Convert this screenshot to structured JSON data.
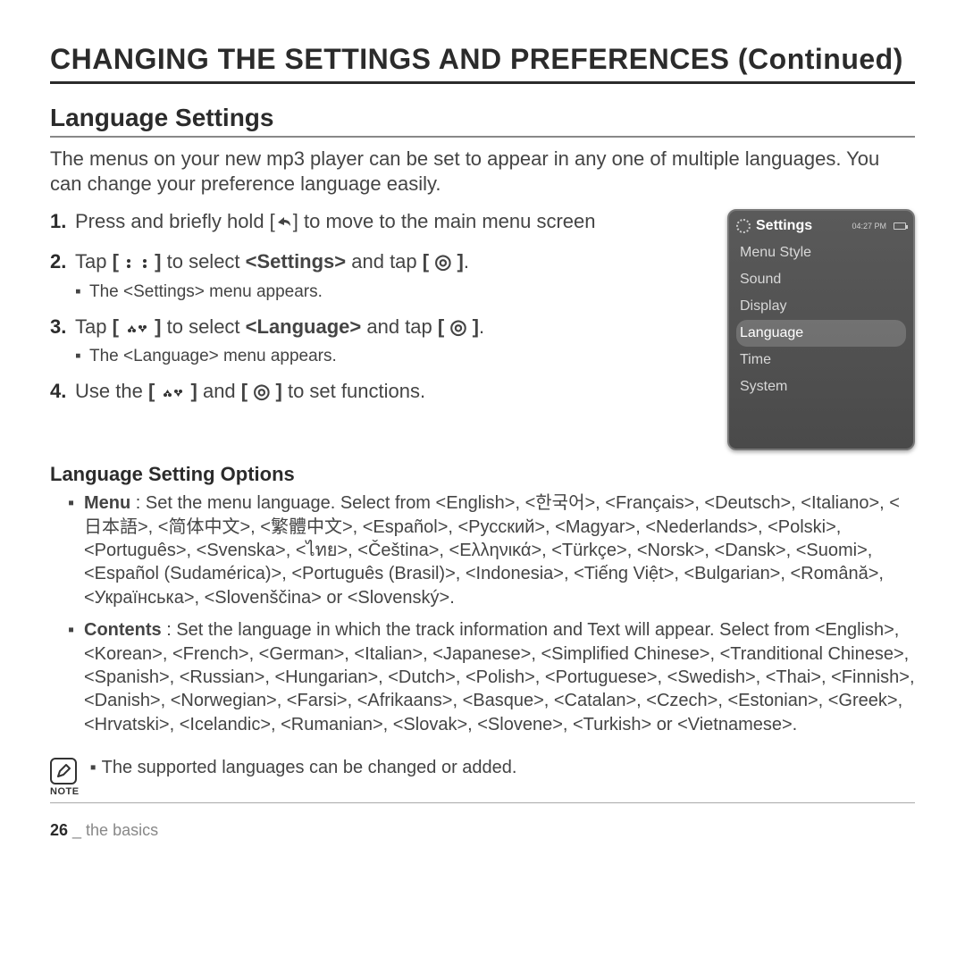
{
  "page_title": "CHANGING THE SETTINGS AND PREFERENCES (Continued)",
  "section_title": "Language Settings",
  "intro": "The menus on your new mp3 player can be set to appear in any one of multiple languages. You can change your preference language easily.",
  "steps": {
    "s1": {
      "num": "1.",
      "body_a": "Press and briefly hold [",
      "body_b": "] to move to the main menu screen"
    },
    "s2": {
      "num": "2.",
      "body_a": "Tap ",
      "bold": "[ ",
      "body_mid": " ]",
      "body_b": " to select ",
      "target": "<Settings>",
      "body_c": " and tap ",
      "btn": "[ ◎ ]",
      "body_d": ".",
      "sub": "The <Settings> menu appears."
    },
    "s3": {
      "num": "3.",
      "body_a": "Tap ",
      "bold": "[ ",
      "body_mid": " ]",
      "body_b": " to select ",
      "target": "<Language>",
      "body_c": " and tap ",
      "btn": "[ ◎ ]",
      "body_d": ".",
      "sub": "The <Language> menu appears."
    },
    "s4": {
      "num": "4.",
      "body_a": "Use the ",
      "bold": "[ ",
      "body_mid": " ]",
      "body_b": " and ",
      "btn": "[ ◎ ]",
      "body_c": " to set functions."
    }
  },
  "device": {
    "title": "Settings",
    "time": "04:27 PM",
    "items": [
      "Menu Style",
      "Sound",
      "Display",
      "Language",
      "Time",
      "System"
    ],
    "selected_index": 3
  },
  "options_title": "Language Setting Options",
  "options": {
    "menu": {
      "lead": "Menu",
      "text": " : Set the menu language. Select from <English>, <한국어>, <Français>, <Deutsch>, <Italiano>, <日本語>, <简体中文>, <繁體中文>, <Español>, <Русский>, <Magyar>, <Nederlands>, <Polski>, <Português>, <Svenska>, <ไทย>, <Čeština>, <Ελληνικά>, <Türkçe>, <Norsk>, <Dansk>, <Suomi>, <Español (Sudamérica)>, <Português (Brasil)>, <Indonesia>, <Tiếng Việt>, <Bulgarian>, <Română>, <Українська>, <Slovenščina> or <Slovenský>."
    },
    "contents": {
      "lead": "Contents",
      "text": " : Set the language in which the track information and Text will appear. Select from <English>, <Korean>, <French>, <German>, <Italian>, <Japanese>, <Simplified Chinese>, <Tranditional Chinese>, <Spanish>, <Russian>, <Hungarian>, <Dutch>, <Polish>, <Portuguese>, <Swedish>, <Thai>, <Finnish>, <Danish>, <Norwegian>, <Farsi>, <Afrikaans>, <Basque>, <Catalan>, <Czech>, <Estonian>, <Greek>, <Hrvatski>, <Icelandic>, <Rumanian>, <Slovak>, <Slovene>, <Turkish> or <Vietnamese>."
    }
  },
  "note_label": "NOTE",
  "note_text": "The supported languages can be changed or added.",
  "footer": {
    "page": "26",
    "sep": " _ ",
    "section": "the basics"
  }
}
